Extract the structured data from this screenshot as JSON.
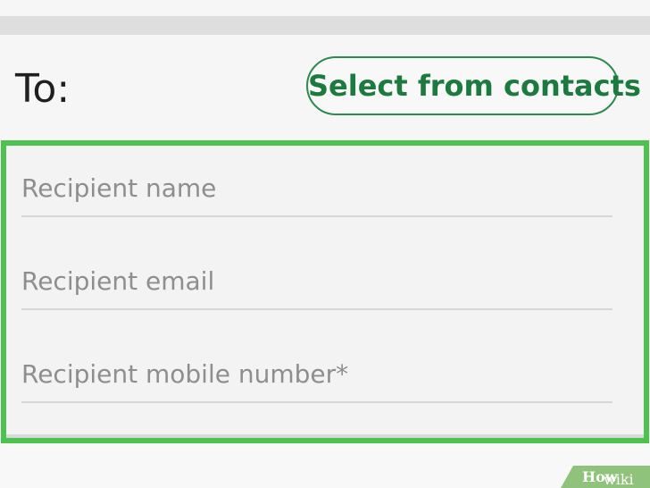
{
  "recipient": {
    "to_label": "To:",
    "select_button_label": "Select from contacts"
  },
  "form": {
    "fields": [
      {
        "placeholder": "Recipient name",
        "value": ""
      },
      {
        "placeholder": "Recipient email",
        "value": ""
      },
      {
        "placeholder": "Recipient mobile number*",
        "value": ""
      }
    ]
  },
  "colors": {
    "accent_green": "#1c7a3e",
    "highlight_green": "#4ec24e"
  },
  "watermark": {
    "prefix": "wiki",
    "suffix": "How"
  }
}
